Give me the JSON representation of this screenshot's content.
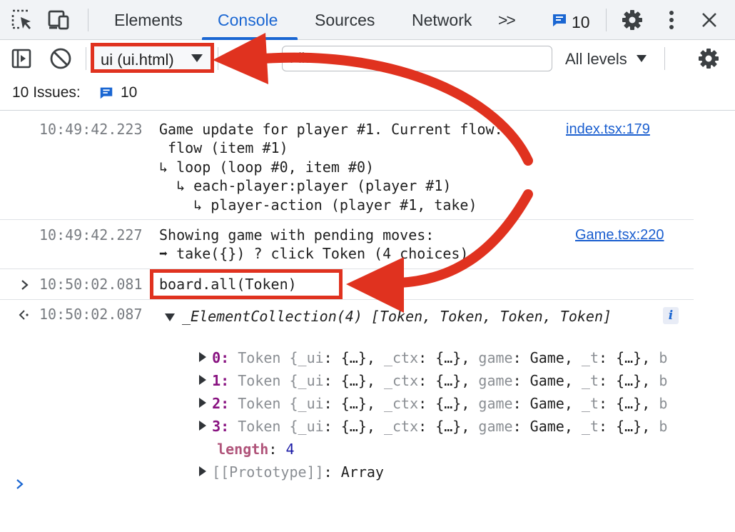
{
  "tabbar": {
    "tabs": [
      {
        "label": "Elements",
        "active": false
      },
      {
        "label": "Console",
        "active": true
      },
      {
        "label": "Sources",
        "active": false
      },
      {
        "label": "Network",
        "active": false
      }
    ],
    "more_label": ">>",
    "messages_count": "10",
    "icons": [
      "inspect-element-icon",
      "device-toolbar-icon",
      "more-tabs-icon",
      "messages-icon",
      "settings-icon",
      "kebab-menu-icon",
      "close-icon"
    ]
  },
  "toolbar": {
    "context": "ui (ui.html)",
    "filter_placeholder": "Filter",
    "levels": "All levels",
    "icons": [
      "sidebar-toggle-icon",
      "clear-console-icon",
      "console-settings-icon"
    ]
  },
  "issues": {
    "label": "10 Issues:",
    "count": "10"
  },
  "console": {
    "log1": {
      "time": "10:49:42.223",
      "lines": [
        "Game update for player #1. Current flow:",
        " flow (item #1)",
        "↳ loop (loop #0, item #0)",
        "  ↳ each-player:player (player #1)",
        "    ↳ player-action (player #1, take)"
      ],
      "source": "index.tsx:179"
    },
    "log2": {
      "time": "10:49:42.227",
      "lines": [
        "Showing game with pending moves:",
        "➡ take({}) ? click Token (4 choices)"
      ],
      "source": "Game.tsx:220"
    },
    "input": {
      "time": "10:50:02.081",
      "command": "board.all(Token)"
    },
    "result": {
      "time": "10:50:02.087",
      "summary": "_ElementCollection(4) [Token, Token, Token, Token]",
      "info": "i",
      "entries": [
        {
          "key": "0",
          "value_parts": [
            "Token {",
            "_ui",
            ": {…}, ",
            "_ctx",
            ": {…}, ",
            "game",
            ": Game, ",
            "_t",
            ": {…}, ",
            "b"
          ]
        },
        {
          "key": "1",
          "value_parts": [
            "Token {",
            "_ui",
            ": {…}, ",
            "_ctx",
            ": {…}, ",
            "game",
            ": Game, ",
            "_t",
            ": {…}, ",
            "b"
          ]
        },
        {
          "key": "2",
          "value_parts": [
            "Token {",
            "_ui",
            ": {…}, ",
            "_ctx",
            ": {…}, ",
            "game",
            ": Game, ",
            "_t",
            ": {…}, ",
            "b"
          ]
        },
        {
          "key": "3",
          "value_parts": [
            "Token {",
            "_ui",
            ": {…}, ",
            "_ctx",
            ": {…}, ",
            "game",
            ": Game, ",
            "_t",
            ": {…}, ",
            "b"
          ]
        }
      ],
      "length_key": "length",
      "length_value": "4",
      "prototype": "[[Prototype]]",
      "prototype_value": "Array"
    }
  },
  "colors": {
    "highlight": "#e0321f",
    "accent": "#1a66d2"
  }
}
